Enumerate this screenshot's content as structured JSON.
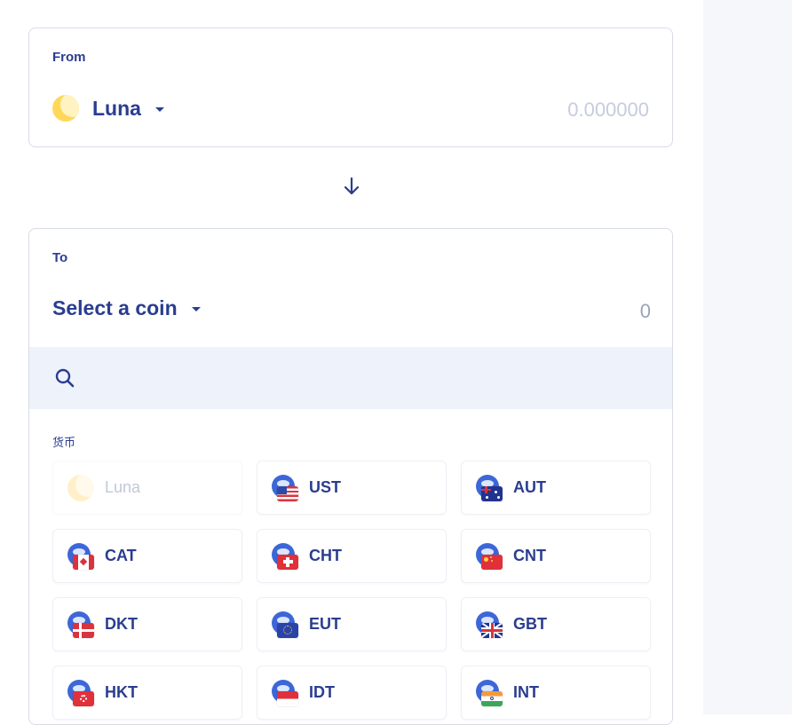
{
  "from": {
    "label": "From",
    "coin": "Luna",
    "amount_placeholder": "0.000000"
  },
  "to": {
    "label": "To",
    "select_label": "Select a coin",
    "amount": "0"
  },
  "search": {
    "placeholder": ""
  },
  "section": {
    "title": "货币"
  },
  "coins": [
    {
      "code": "Luna",
      "icon": "luna-icon",
      "disabled": true
    },
    {
      "code": "UST",
      "icon": "us-flag-icon"
    },
    {
      "code": "AUT",
      "icon": "au-flag-icon"
    },
    {
      "code": "CAT",
      "icon": "ca-flag-icon"
    },
    {
      "code": "CHT",
      "icon": "ch-flag-icon"
    },
    {
      "code": "CNT",
      "icon": "cn-flag-icon"
    },
    {
      "code": "DKT",
      "icon": "dk-flag-icon"
    },
    {
      "code": "EUT",
      "icon": "eu-flag-icon"
    },
    {
      "code": "GBT",
      "icon": "gb-flag-icon"
    },
    {
      "code": "HKT",
      "icon": "hk-flag-icon"
    },
    {
      "code": "IDT",
      "icon": "id-flag-icon"
    },
    {
      "code": "INT",
      "icon": "in-flag-icon"
    }
  ],
  "colors": {
    "primary": "#2a3d8f",
    "muted": "#c7ccdd",
    "search_bg": "#eef2fb",
    "luna": "#ffd85a"
  }
}
